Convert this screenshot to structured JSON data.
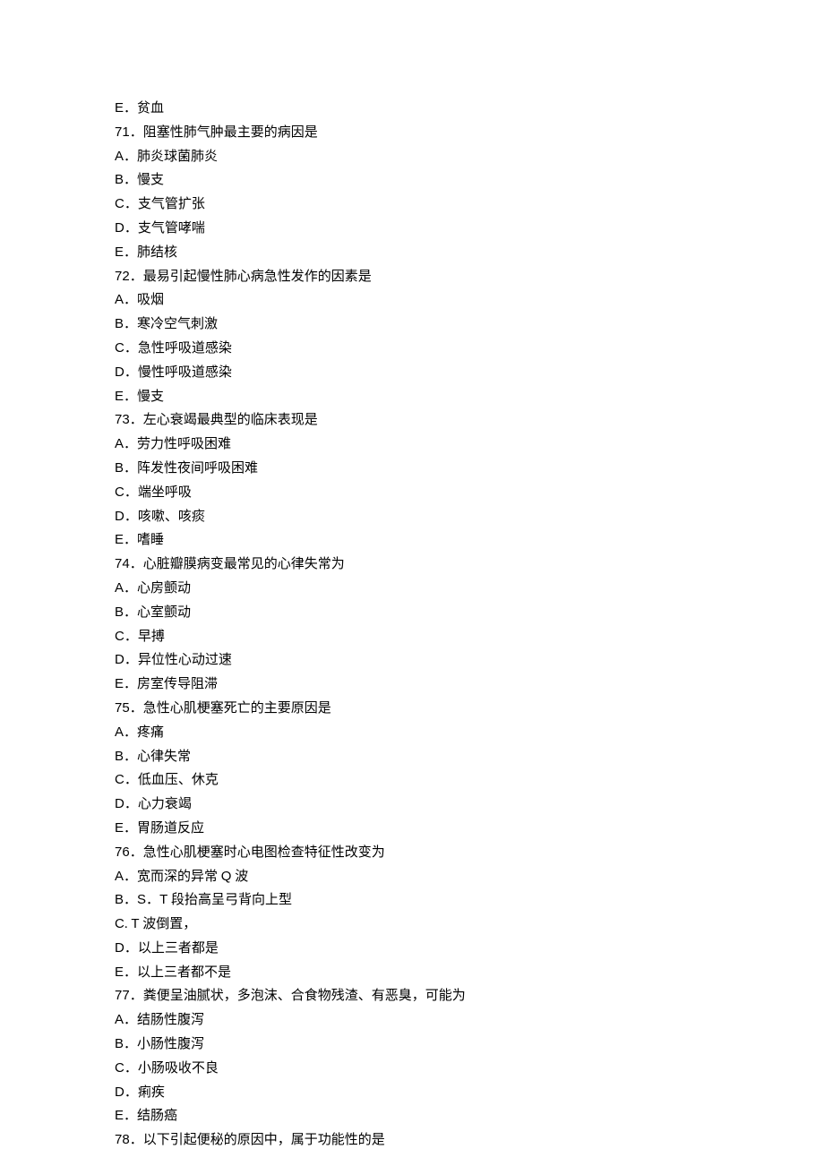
{
  "lines": [
    {
      "letter": "E",
      "text": "贫血"
    },
    {
      "letter": "71",
      "text": "阻塞性肺气肿最主要的病因是"
    },
    {
      "letter": "A",
      "text": "肺炎球菌肺炎"
    },
    {
      "letter": "B",
      "text": "慢支"
    },
    {
      "letter": "C",
      "text": "支气管扩张"
    },
    {
      "letter": "D",
      "text": "支气管哮喘"
    },
    {
      "letter": "E",
      "text": "肺结核"
    },
    {
      "letter": "72",
      "text": "最易引起慢性肺心病急性发作的因素是"
    },
    {
      "letter": "A",
      "text": "吸烟"
    },
    {
      "letter": "B",
      "text": "寒冷空气刺激"
    },
    {
      "letter": "C",
      "text": "急性呼吸道感染"
    },
    {
      "letter": "D",
      "text": "慢性呼吸道感染"
    },
    {
      "letter": "E",
      "text": "慢支"
    },
    {
      "letter": "73",
      "text": "左心衰竭最典型的临床表现是"
    },
    {
      "letter": "A",
      "text": "劳力性呼吸困难"
    },
    {
      "letter": "B",
      "text": "阵发性夜间呼吸困难"
    },
    {
      "letter": "C",
      "text": "端坐呼吸"
    },
    {
      "letter": "D",
      "text": "咳嗽、咳痰"
    },
    {
      "letter": "E",
      "text": "嗜睡"
    },
    {
      "letter": "74",
      "text": "心脏瓣膜病变最常见的心律失常为"
    },
    {
      "letter": "A",
      "text": "心房颤动"
    },
    {
      "letter": "B",
      "text": "心室颤动"
    },
    {
      "letter": "C",
      "text": "早搏"
    },
    {
      "letter": "D",
      "text": "异位性心动过速"
    },
    {
      "letter": "E",
      "text": "房室传导阻滞"
    },
    {
      "letter": "75",
      "text": "急性心肌梗塞死亡的主要原因是"
    },
    {
      "letter": "A",
      "text": "疼痛"
    },
    {
      "letter": "B",
      "text": "心律失常"
    },
    {
      "letter": "C",
      "text": "低血压、休克"
    },
    {
      "letter": "D",
      "text": "心力衰竭"
    },
    {
      "letter": "E",
      "text": "胃肠道反应"
    },
    {
      "letter": "76",
      "text": "急性心肌梗塞时心电图检查特征性改变为"
    },
    {
      "letter": "A",
      "text": "宽而深的异常 Q 波",
      "mixed": true,
      "runs": [
        {
          "t": "宽而深的异常 ",
          "latin": false
        },
        {
          "t": "Q",
          "latin": true
        },
        {
          "t": " 波",
          "latin": false
        }
      ]
    },
    {
      "letter": "B",
      "text": "S．T 段抬高呈弓背向上型",
      "mixed": true,
      "runs": [
        {
          "t": "S",
          "latin": true
        },
        {
          "t": "．",
          "latin": false
        },
        {
          "t": "T",
          "latin": true
        },
        {
          "t": " 段抬高呈弓背向上型",
          "latin": false
        }
      ]
    },
    {
      "letter": "C",
      "sep": ". ",
      "text": "T 波倒置，",
      "mixed": true,
      "runs": [
        {
          "t": "T",
          "latin": true
        },
        {
          "t": " 波倒置，",
          "latin": false
        }
      ]
    },
    {
      "letter": "D",
      "text": "以上三者都是"
    },
    {
      "letter": "E",
      "text": "以上三者都不是"
    },
    {
      "letter": "77",
      "text": "粪便呈油腻状，多泡沫、合食物残渣、有恶臭，可能为"
    },
    {
      "letter": "A",
      "text": "结肠性腹泻"
    },
    {
      "letter": "B",
      "text": "小肠性腹泻"
    },
    {
      "letter": "C",
      "text": "小肠吸收不良"
    },
    {
      "letter": "D",
      "text": "痢疾"
    },
    {
      "letter": "E",
      "text": "结肠癌"
    },
    {
      "letter": "78",
      "text": "以下引起便秘的原因中，属于功能性的是"
    }
  ]
}
